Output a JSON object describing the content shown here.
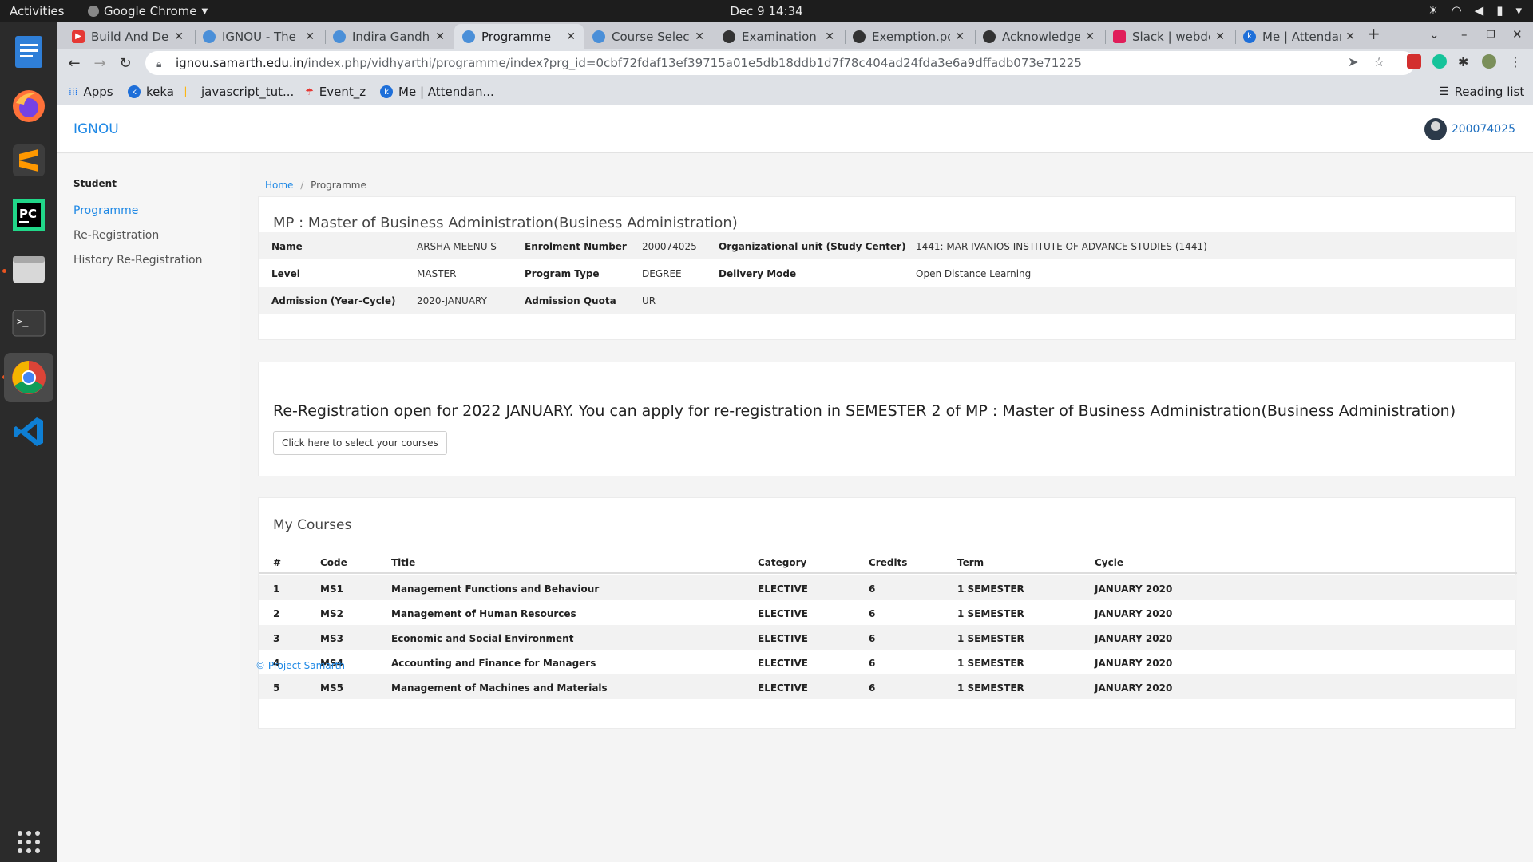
{
  "os": {
    "activities": "Activities",
    "app_menu": "Google Chrome",
    "clock": "Dec 9  14:34"
  },
  "browser": {
    "tabs": [
      {
        "title": "Build And Dep",
        "icon_color": "#e53935",
        "icon": "youtube-icon"
      },
      {
        "title": "IGNOU - The Pe",
        "icon_color": "#4a8fd8",
        "icon": "shield-icon"
      },
      {
        "title": "Indira Gandhi",
        "icon_color": "#4a8fd8",
        "icon": "shield-icon"
      },
      {
        "title": "Programme",
        "icon_color": "#4a8fd8",
        "icon": "shield-icon"
      },
      {
        "title": "Course Selecti",
        "icon_color": "#4a8fd8",
        "icon": "shield-icon"
      },
      {
        "title": "Examination F",
        "icon_color": "#333333",
        "icon": "globe-icon"
      },
      {
        "title": "Exemption.pd",
        "icon_color": "#333333",
        "icon": "globe-icon"
      },
      {
        "title": "Acknowledge",
        "icon_color": "#333333",
        "icon": "globe-icon"
      },
      {
        "title": "Slack | webde",
        "icon_color": "#e01e5a",
        "icon": "slack-icon"
      },
      {
        "title": "Me | Attendan",
        "icon_color": "#1e6fd9",
        "icon": "keka-icon"
      }
    ],
    "url_host": "ignou.samarth.edu.in",
    "url_path": "/index.php/vidhyarthi/programme/index?prg_id=0cbf72fdaf13ef39715a01e5db18ddb1d7f78c404ad24fda3e6a9dffadb073e71225",
    "bookmarks": [
      "Apps",
      "keka",
      "javascript_tut...",
      "Event_z",
      "Me | Attendan..."
    ],
    "reading_list": "Reading list"
  },
  "app": {
    "brand": "IGNOU",
    "user_id": "200074025",
    "sidebar": {
      "section": "Student",
      "items": [
        "Programme",
        "Re-Registration",
        "History Re-Registration"
      ]
    },
    "breadcrumb": {
      "home": "Home",
      "sep": "/",
      "current": "Programme"
    }
  },
  "programme": {
    "title": "MP : Master of Business Administration(Business Administration)",
    "rows": [
      [
        {
          "label": "Name",
          "value": "ARSHA MEENU S"
        },
        {
          "label": "Enrolment Number",
          "value": "200074025"
        },
        {
          "label": "Organizational unit (Study Center)",
          "value": "1441: MAR IVANIOS INSTITUTE OF ADVANCE STUDIES (1441)"
        }
      ],
      [
        {
          "label": "Level",
          "value": "MASTER"
        },
        {
          "label": "Program Type",
          "value": "DEGREE"
        },
        {
          "label": "Delivery Mode",
          "value": "Open Distance Learning"
        }
      ],
      [
        {
          "label": "Admission (Year-Cycle)",
          "value": "2020-JANUARY"
        },
        {
          "label": "Admission Quota",
          "value": "UR"
        }
      ]
    ]
  },
  "reregistration": {
    "message": "Re-Registration open for 2022 JANUARY. You can apply for re-registration in SEMESTER 2 of MP : Master of Business Administration(Business Administration)",
    "button": "Click here to select your courses"
  },
  "courses": {
    "title": "My Courses",
    "headers": [
      "#",
      "Code",
      "Title",
      "Category",
      "Credits",
      "Term",
      "Cycle"
    ],
    "rows": [
      [
        "1",
        "MS1",
        "Management Functions and Behaviour",
        "ELECTIVE",
        "6",
        "1 SEMESTER",
        "JANUARY 2020"
      ],
      [
        "2",
        "MS2",
        "Management of Human Resources",
        "ELECTIVE",
        "6",
        "1 SEMESTER",
        "JANUARY 2020"
      ],
      [
        "3",
        "MS3",
        "Economic and Social Environment",
        "ELECTIVE",
        "6",
        "1 SEMESTER",
        "JANUARY 2020"
      ],
      [
        "4",
        "MS4",
        "Accounting and Finance for Managers",
        "ELECTIVE",
        "6",
        "1 SEMESTER",
        "JANUARY 2020"
      ],
      [
        "5",
        "MS5",
        "Management of Machines and Materials",
        "ELECTIVE",
        "6",
        "1 SEMESTER",
        "JANUARY 2020"
      ]
    ]
  },
  "footer": "© Project Samarth"
}
